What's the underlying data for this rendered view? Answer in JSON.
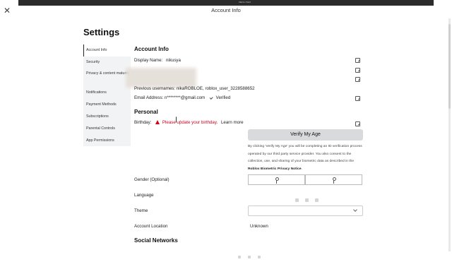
{
  "window": {
    "title": "Account Info",
    "mini_caption": "MENU.ITEM"
  },
  "page_title": "Settings",
  "sidebar": {
    "items": [
      {
        "label": "Account Info"
      },
      {
        "label": "Security"
      },
      {
        "label": "Privacy & content maturity"
      },
      {
        "label": "Notifications"
      },
      {
        "label": "Payment Methods"
      },
      {
        "label": "Subscriptions"
      },
      {
        "label": "Parental Controls"
      },
      {
        "label": "App Permissions"
      }
    ]
  },
  "account_info": {
    "heading": "Account Info",
    "display_name_label": "Display Name:",
    "display_name_value": "nikusya",
    "previous_usernames_label": "Previous usernames:",
    "previous_usernames_value": "nikaROBLOE, roblox_user_3228588652",
    "email_label": "Email Address:",
    "email_value": "n********@gmail.com",
    "email_status": "Verified"
  },
  "personal": {
    "heading": "Personal",
    "birthday_label": "Birthday:",
    "birthday_warning": "Please update your birthday.",
    "learn_more": "Learn more",
    "verify_button": "Verify My Age",
    "notice_text": "By clicking 'Verify My Age' you will be completing an ID verification process operated by our third party service provider. You also consent to the collection, use, and sharing of your biometric data as described in the",
    "notice_link": "Roblox Biometric Privacy Notice",
    "notice_end": ".",
    "gender_label": "Gender (Optional)",
    "language_label": "Language",
    "theme_label": "Theme",
    "theme_value": "",
    "location_label": "Account Location",
    "location_value": "Unknown"
  },
  "social": {
    "heading": "Social Networks"
  },
  "colors": {
    "warning": "#d0021b",
    "button_bg": "#d9dadb",
    "sidebar_bg": "#f2f3f4"
  }
}
